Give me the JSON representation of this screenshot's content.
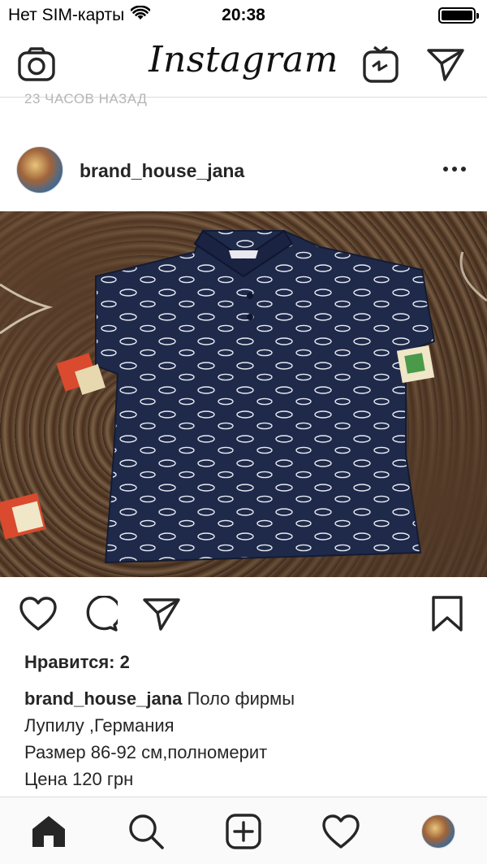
{
  "status_bar": {
    "carrier": "Нет SIM-карты",
    "time": "20:38",
    "wifi_icon": "wifi-icon",
    "battery_icon": "battery-icon"
  },
  "nav": {
    "logo": "Instagram",
    "camera_icon": "camera-icon",
    "igtv_icon": "igtv-icon",
    "direct_icon": "paper-plane-icon"
  },
  "feed": {
    "time_ago": "23 ЧАСОВ НАЗАД"
  },
  "post": {
    "username": "brand_house_jana",
    "more_icon": "more-horizontal-icon",
    "photo_alt": "navy polo shirt with white car print on a brown fur rug with toy cubes",
    "likes": "Нравится: 2",
    "caption_user": "brand_house_jana",
    "caption_lines": [
      "Поло фирмы",
      "Лупилу ,Германия",
      "Размер 86-92 см,полномерит",
      "Цена 120 грн"
    ]
  },
  "actions": {
    "like_icon": "heart-icon",
    "comment_icon": "comment-icon",
    "share_icon": "paper-plane-icon",
    "save_icon": "bookmark-icon"
  },
  "tab_bar": {
    "items": [
      "home-icon",
      "search-icon",
      "add-icon",
      "activity-heart-icon",
      "profile-avatar"
    ]
  },
  "colors": {
    "text": "#262626",
    "secondary_text": "#b5b5b5",
    "divider": "#dbdbdb",
    "shirt_navy": "#1f2a4a"
  }
}
